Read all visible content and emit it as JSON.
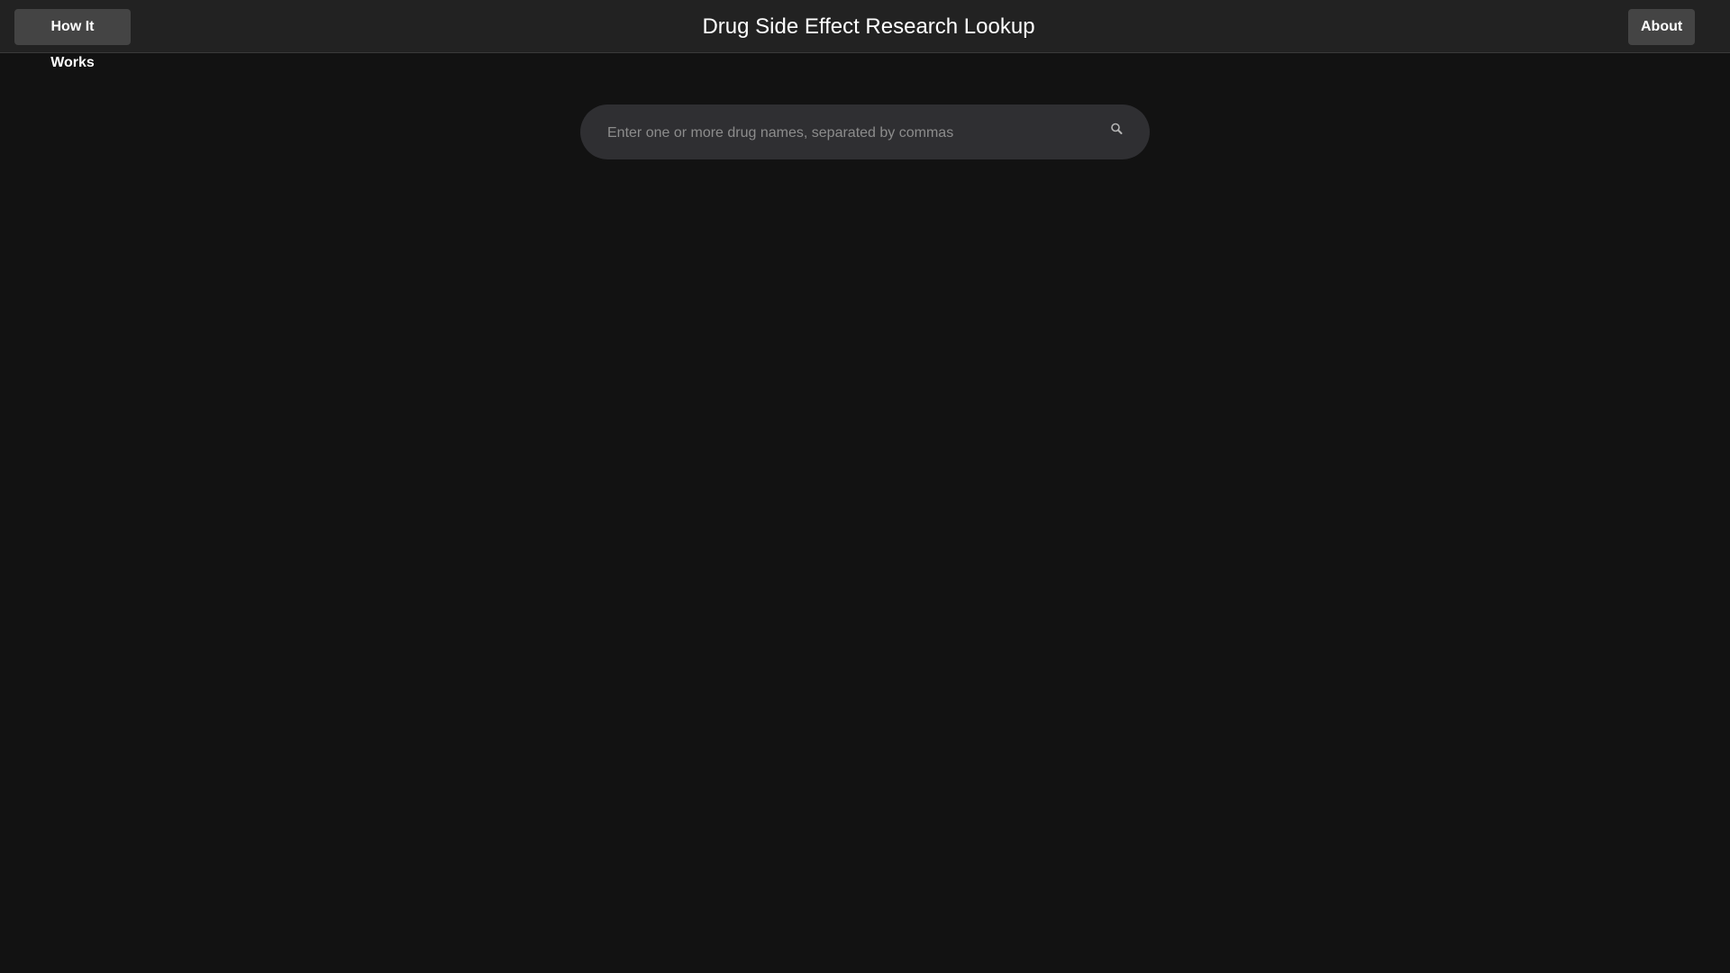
{
  "header": {
    "title": "Drug Side Effect Research Lookup",
    "how_it_works_label": "How It Works",
    "about_label": "About"
  },
  "search": {
    "placeholder": "Enter one or more drug names, separated by commas",
    "value": "",
    "icon": "search-icon"
  },
  "colors": {
    "background": "#121212",
    "header": "#222222",
    "button": "#444444",
    "search_field": "#2f2f32"
  }
}
